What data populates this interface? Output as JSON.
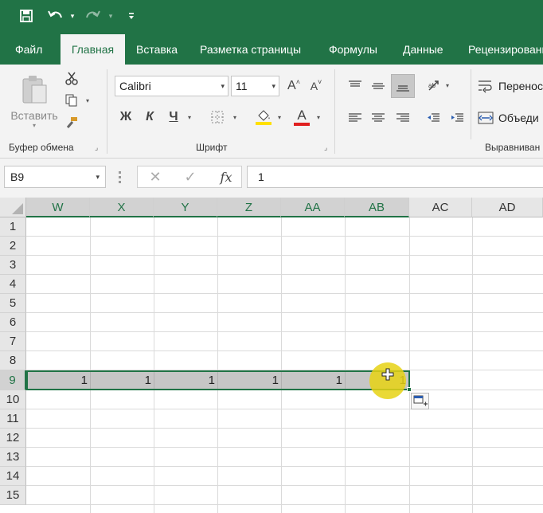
{
  "qat": {
    "save_icon": "save-icon",
    "undo_icon": "undo-icon",
    "redo_icon": "redo-icon",
    "customize_icon": "customize-qat-icon"
  },
  "tabs": [
    {
      "label": "Файл"
    },
    {
      "label": "Главная"
    },
    {
      "label": "Вставка"
    },
    {
      "label": "Разметка страницы"
    },
    {
      "label": "Формулы"
    },
    {
      "label": "Данные"
    },
    {
      "label": "Рецензировани"
    }
  ],
  "ribbon": {
    "clipboard": {
      "paste_label": "Вставить",
      "group_label": "Буфер обмена"
    },
    "font": {
      "font_name": "Calibri",
      "font_size": "11",
      "bold": "Ж",
      "italic": "К",
      "underline": "Ч",
      "grow_font": "A",
      "shrink_font": "A",
      "font_color_letter": "A",
      "group_label": "Шрифт"
    },
    "alignment": {
      "wrap_label": "Перенос",
      "merge_label": "Объеди",
      "group_label": "Выравниван"
    }
  },
  "formula_bar": {
    "name_box": "B9",
    "fx": "fx",
    "value": "1"
  },
  "sheet": {
    "columns": [
      "W",
      "X",
      "Y",
      "Z",
      "AA",
      "AB",
      "AC",
      "AD"
    ],
    "rows": [
      "1",
      "2",
      "3",
      "4",
      "5",
      "6",
      "7",
      "8",
      "9",
      "10",
      "11",
      "12",
      "13",
      "14",
      "15"
    ],
    "selected_row": "9",
    "row9_values": [
      "1",
      "1",
      "1",
      "1",
      "1",
      "1"
    ]
  },
  "colors": {
    "accent": "#217346",
    "ribbon_bg": "#f3f3f3",
    "selection_fill": "#c6c6c6",
    "cursor_highlight": "#e6d214",
    "font_color_bar": "#e02020",
    "fill_color_bar": "#ffe000"
  }
}
